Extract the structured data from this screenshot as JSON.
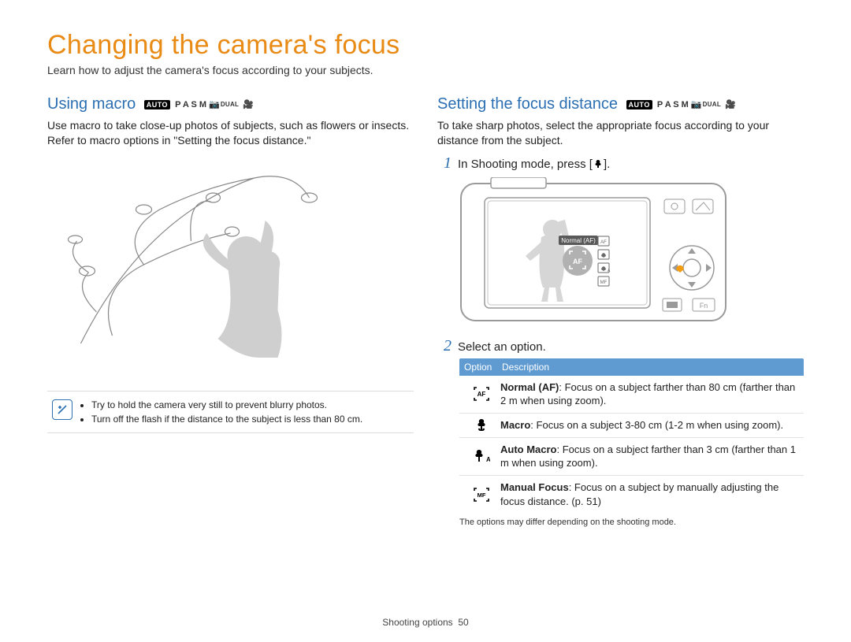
{
  "page": {
    "title": "Changing the camera's focus",
    "intro": "Learn how to adjust the camera's focus according to your subjects.",
    "footer_section": "Shooting options",
    "footer_page": "50"
  },
  "mode_badges": {
    "auto": "AUTO",
    "letters": "P A S M",
    "dual": "DUAL"
  },
  "left": {
    "heading": "Using macro",
    "body": "Use macro to take close-up photos of subjects, such as flowers or insects. Refer to macro options in \"Setting the focus distance.\"",
    "tips": [
      "Try to hold the camera very still to prevent blurry photos.",
      "Turn off the flash if the distance to the subject is less than 80 cm."
    ]
  },
  "right": {
    "heading": "Setting the focus distance",
    "body": "To take sharp photos, select the appropriate focus according to your distance from the subject.",
    "step1_prefix": "In Shooting mode, press [",
    "step1_suffix": "].",
    "step2": "Select an option.",
    "camera_label": "Normal (AF)",
    "table": {
      "th_option": "Option",
      "th_desc": "Description",
      "rows": [
        {
          "icon": "normal-af-icon",
          "bold": "Normal (AF)",
          "text": ": Focus on a subject farther than 80 cm (farther than 2 m when using zoom)."
        },
        {
          "icon": "macro-flower-icon",
          "bold": "Macro",
          "text": ": Focus on a subject 3-80 cm (1-2 m when using zoom)."
        },
        {
          "icon": "auto-macro-icon",
          "bold": "Auto Macro",
          "text": ": Focus on a subject farther than 3 cm (farther than 1 m when using zoom)."
        },
        {
          "icon": "manual-focus-icon",
          "bold": "Manual Focus",
          "text": ": Focus on a subject by manually adjusting the focus distance. (p. 51)"
        }
      ],
      "note": "The options may differ depending on the shooting mode."
    }
  }
}
